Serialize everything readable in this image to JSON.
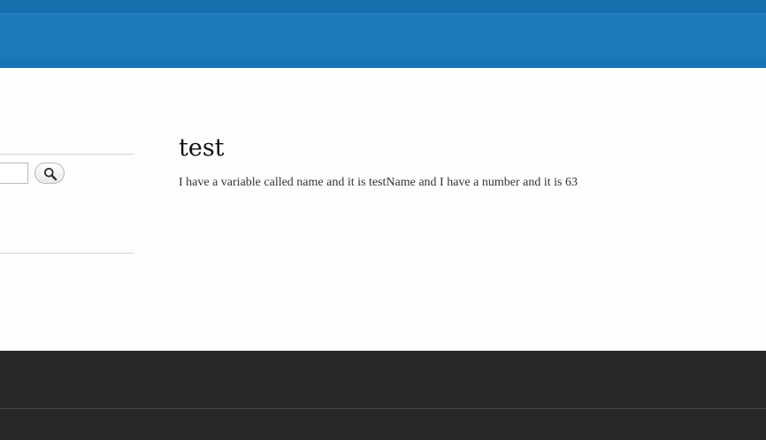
{
  "header": {
    "logo_fragment": "“ ”"
  },
  "sidebar": {
    "search": {
      "value": "",
      "placeholder": ""
    },
    "search_button_icon": "magnifier-icon"
  },
  "main": {
    "title": "test",
    "body": "I have a variable called name and it is testName and I have a number and it is 63"
  },
  "colors": {
    "header": "#1b7ab9",
    "footer": "#282828",
    "background": "#fefefe"
  }
}
